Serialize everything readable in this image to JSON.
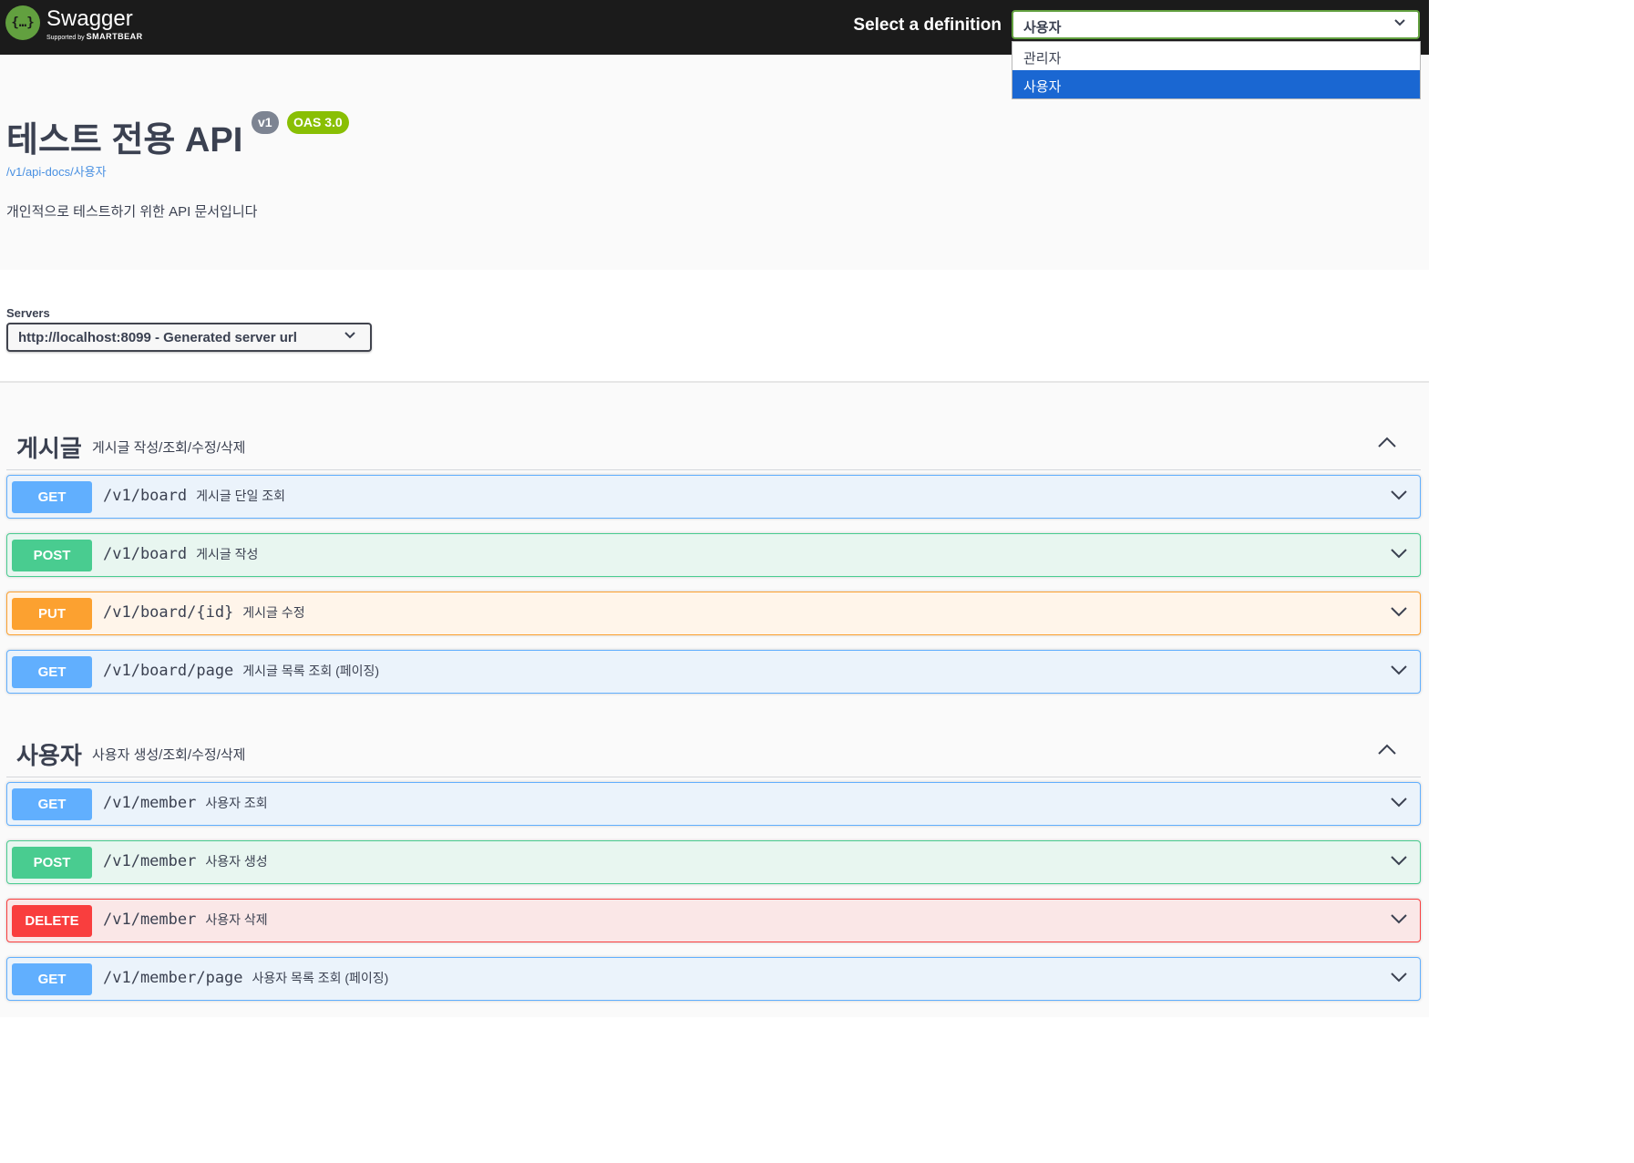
{
  "topbar": {
    "logo_glyph": "{…}",
    "logo_name": "Swagger",
    "logo_sub_prefix": "Supported by",
    "logo_sub_brand": "SMARTBEAR",
    "definition_label": "Select a definition",
    "definition_selected": "사용자",
    "definition_options": [
      "관리자",
      "사용자"
    ]
  },
  "info": {
    "title": "테스트 전용 API",
    "version_badge": "v1",
    "oas_badge": "OAS 3.0",
    "spec_link": "/v1/api-docs/사용자",
    "description": "개인적으로 테스트하기 위한 API 문서입니다"
  },
  "servers": {
    "label": "Servers",
    "selected": "http://localhost:8099 - Generated server url"
  },
  "tags": [
    {
      "name": "게시글",
      "description": "게시글 작성/조회/수정/삭제",
      "operations": [
        {
          "method": "GET",
          "path": "/v1/board",
          "summary": "게시글 단일 조회"
        },
        {
          "method": "POST",
          "path": "/v1/board",
          "summary": "게시글 작성"
        },
        {
          "method": "PUT",
          "path": "/v1/board/{id}",
          "summary": "게시글 수정"
        },
        {
          "method": "GET",
          "path": "/v1/board/page",
          "summary": "게시글 목록 조회 (페이징)"
        }
      ]
    },
    {
      "name": "사용자",
      "description": "사용자 생성/조회/수정/삭제",
      "operations": [
        {
          "method": "GET",
          "path": "/v1/member",
          "summary": "사용자 조회"
        },
        {
          "method": "POST",
          "path": "/v1/member",
          "summary": "사용자 생성"
        },
        {
          "method": "DELETE",
          "path": "/v1/member",
          "summary": "사용자 삭제"
        },
        {
          "method": "GET",
          "path": "/v1/member/page",
          "summary": "사용자 목록 조회 (페이징)"
        }
      ]
    }
  ],
  "colors": {
    "get": "#61affe",
    "post": "#49cc90",
    "put": "#fca130",
    "delete": "#f93e3e",
    "topbar": "#1b1b1b",
    "accent": "#62a03f"
  }
}
